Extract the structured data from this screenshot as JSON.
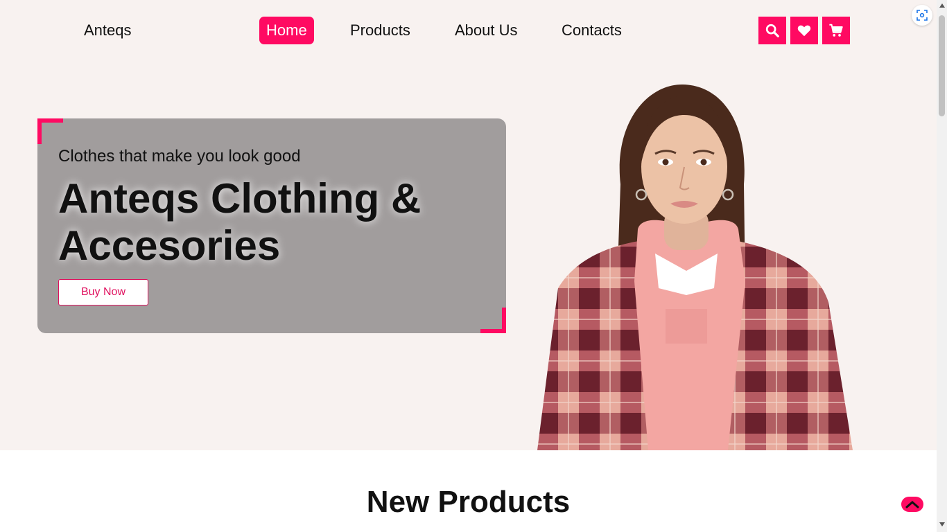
{
  "header": {
    "logo": "Anteqs",
    "nav": [
      {
        "label": "Home",
        "active": true
      },
      {
        "label": "Products",
        "active": false
      },
      {
        "label": "About Us",
        "active": false
      },
      {
        "label": "Contacts",
        "active": false
      }
    ],
    "icons": [
      "search-icon",
      "heart-icon",
      "cart-icon"
    ]
  },
  "hero": {
    "tagline": "Clothes that make you look good",
    "title": "Anteqs Clothing & Accesories",
    "button": "Buy Now"
  },
  "sections": {
    "new_products_title": "New Products"
  },
  "colors": {
    "accent": "#ff0a62",
    "hero_background": "#f8f2f0",
    "card_background": "#a19d9d"
  }
}
